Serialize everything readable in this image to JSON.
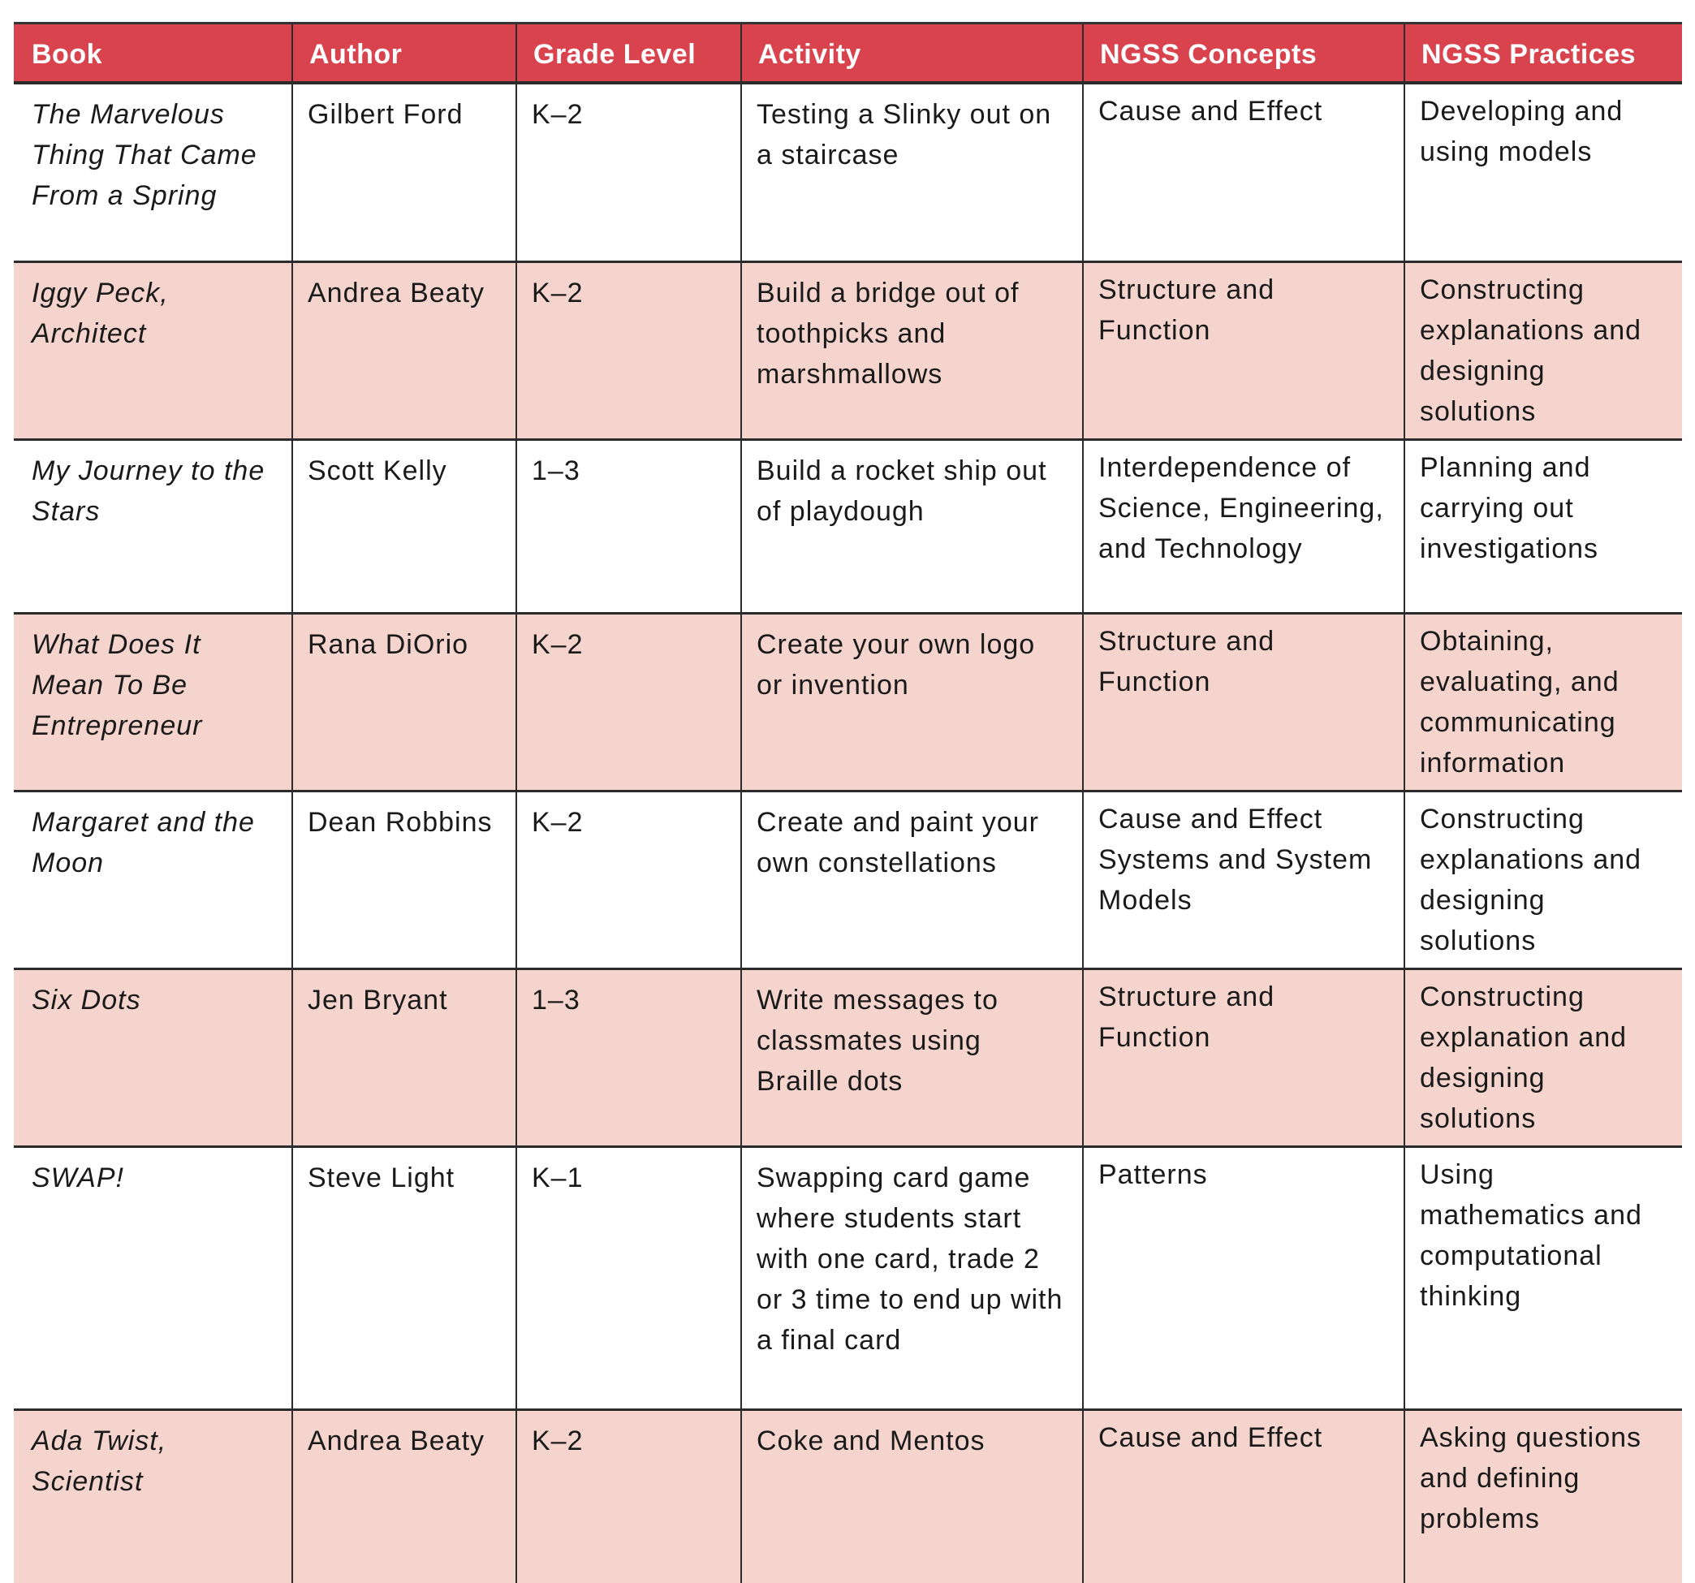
{
  "colors": {
    "header_bg": "#D9434E",
    "header_text": "#ffffff",
    "row_tint": "#F5D4CD"
  },
  "table": {
    "headers": [
      "Book",
      "Author",
      "Grade Level",
      "Activity",
      "NGSS Concepts",
      "NGSS Practices"
    ],
    "rows": [
      {
        "book": "The Marvelous Thing That Came From a Spring",
        "author": "Gilbert Ford",
        "grade": "K–2",
        "activity": "Testing a Slinky out on a staircase",
        "concepts": "Cause and Effect",
        "practices": "Developing and using models"
      },
      {
        "book": "Iggy Peck, Architect",
        "author": "Andrea Beaty",
        "grade": "K–2",
        "activity": "Build a bridge out of toothpicks and marshmallows",
        "concepts": "Structure and Function",
        "practices": "Constructing explanations and designing solutions"
      },
      {
        "book": "My Journey to the Stars",
        "author": "Scott Kelly",
        "grade": "1–3",
        "activity": "Build a rocket ship out of playdough",
        "concepts": "Interdependence of Science, Engineering, and Technology",
        "practices": "Planning and carrying out investigations"
      },
      {
        "book": "What Does It Mean To Be Entrepreneur",
        "author": "Rana DiOrio",
        "grade": "K–2",
        "activity": "Create your own logo or invention",
        "concepts": "Structure and Function",
        "practices": "Obtaining, evaluating, and communicating information"
      },
      {
        "book": "Margaret and the Moon",
        "author": "Dean Robbins",
        "grade": "K–2",
        "activity": "Create and paint your own constellations",
        "concepts": "Cause and Effect Systems and System Models",
        "practices": "Constructing explanations and designing solutions"
      },
      {
        "book": "Six Dots",
        "author": "Jen Bryant",
        "grade": "1–3",
        "activity": "Write messages to classmates using Braille dots",
        "concepts": "Structure and Function",
        "practices": "Constructing explanation and designing solutions"
      },
      {
        "book": "SWAP!",
        "author": "Steve Light",
        "grade": "K–1",
        "activity": "Swapping card game where students start with one card, trade 2 or 3 time to end up with a final card",
        "concepts": "Patterns",
        "practices": "Using mathematics and computational thinking"
      },
      {
        "book": "Ada Twist, Scientist",
        "author": "Andrea Beaty",
        "grade": "K–2",
        "activity": "Coke and Mentos",
        "concepts": "Cause and Effect",
        "practices": "Asking questions and defining problems"
      }
    ]
  }
}
